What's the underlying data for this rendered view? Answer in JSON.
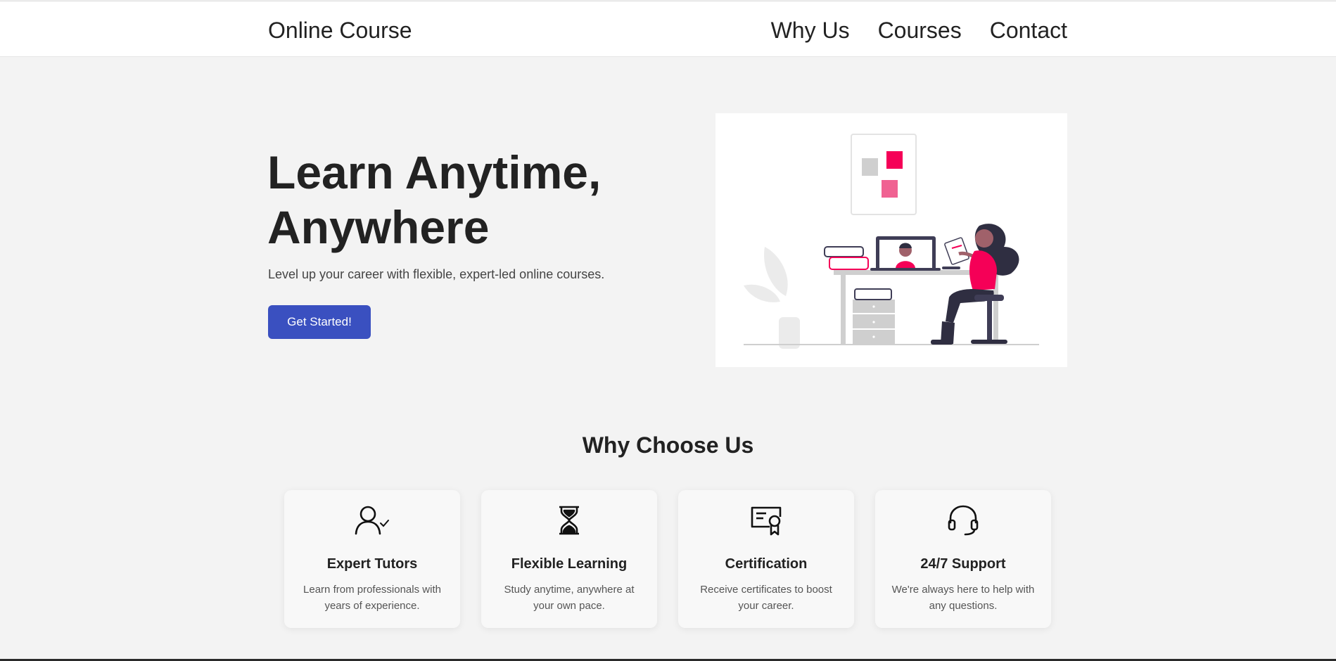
{
  "nav": {
    "brand": "Online Course",
    "links": [
      "Why Us",
      "Courses",
      "Contact"
    ]
  },
  "hero": {
    "title": "Learn Anytime, Anywhere",
    "subtitle": "Level up your career with flexible, expert-led online courses.",
    "cta_label": "Get Started!",
    "illustration_icon": "online-learning-illustration"
  },
  "features": {
    "title": "Why Choose Us",
    "cards": [
      {
        "icon": "user-check-icon",
        "title": "Expert Tutors",
        "desc": "Learn from professionals with years of experience."
      },
      {
        "icon": "hourglass-icon",
        "title": "Flexible Learning",
        "desc": "Study anytime, anywhere at your own pace."
      },
      {
        "icon": "certificate-icon",
        "title": "Certification",
        "desc": "Receive certificates to boost your career."
      },
      {
        "icon": "headset-icon",
        "title": "24/7 Support",
        "desc": "We're always here to help with any questions."
      }
    ]
  },
  "colors": {
    "accent": "#3a50c0",
    "illustration_pink": "#f50057",
    "background": "#f3f3f3"
  }
}
